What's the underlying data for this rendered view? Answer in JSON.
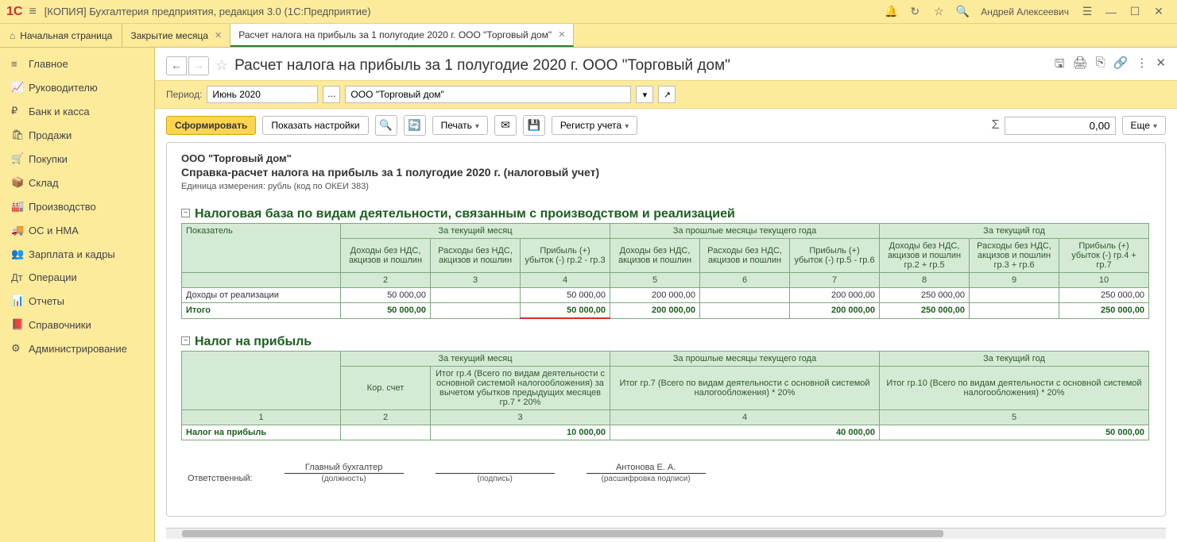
{
  "app": {
    "title": "[КОПИЯ] Бухгалтерия предприятия, редакция 3.0  (1С:Предприятие)",
    "user": "Андрей Алексеевич"
  },
  "tabs": {
    "home": "Начальная страница",
    "list": [
      {
        "label": "Закрытие месяца",
        "active": false
      },
      {
        "label": "Расчет налога на прибыль за 1 полугодие 2020 г. ООО \"Торговый дом\"",
        "active": true
      }
    ]
  },
  "sidebar": [
    {
      "icon": "≡",
      "label": "Главное"
    },
    {
      "icon": "📈",
      "label": "Руководителю"
    },
    {
      "icon": "₽",
      "label": "Банк и касса"
    },
    {
      "icon": "🛍",
      "label": "Продажи"
    },
    {
      "icon": "🛒",
      "label": "Покупки"
    },
    {
      "icon": "📦",
      "label": "Склад"
    },
    {
      "icon": "🏭",
      "label": "Производство"
    },
    {
      "icon": "🚚",
      "label": "ОС и НМА"
    },
    {
      "icon": "👥",
      "label": "Зарплата и кадры"
    },
    {
      "icon": "Дт",
      "label": "Операции"
    },
    {
      "icon": "📊",
      "label": "Отчеты"
    },
    {
      "icon": "📕",
      "label": "Справочники"
    },
    {
      "icon": "⚙",
      "label": "Администрирование"
    }
  ],
  "page": {
    "title": "Расчет налога на прибыль за 1 полугодие 2020 г. ООО \"Торговый дом\"",
    "period_label": "Период:",
    "period_value": "Июнь 2020",
    "org": "ООО \"Торговый дом\"",
    "toolbar": {
      "form": "Сформировать",
      "settings": "Показать настройки",
      "print": "Печать",
      "register": "Регистр учета",
      "more": "Еще"
    },
    "sum_value": "0,00"
  },
  "report": {
    "org_title": "ООО \"Торговый дом\"",
    "doc_title": "Справка-расчет налога на прибыль за 1 полугодие 2020 г. (налоговый учет)",
    "unit": "Единица измерения:  рубль (код по ОКЕИ 383)",
    "section1": {
      "title": "Налоговая база по видам деятельности, связанным с производством и реализацией",
      "col_indicator": "Показатель",
      "grp_current": "За текущий месяц",
      "grp_past": "За прошлые месяцы текущего года",
      "grp_year": "За текущий год",
      "hdr": {
        "c2": "Доходы без НДС, акцизов и пошлин",
        "c3": "Расходы без НДС, акцизов и пошлин",
        "c4": "Прибыль (+) убыток (-) гр.2 - гр.3",
        "c5": "Доходы без НДС, акцизов и пошлин",
        "c6": "Расходы без НДС, акцизов и пошлин",
        "c7": "Прибыль (+) убыток (-) гр.5 - гр.6",
        "c8": "Доходы без НДС, акцизов и пошлин гр.2 + гр.5",
        "c9": "Расходы без НДС, акцизов и пошлин гр.3 + гр.6",
        "c10": "Прибыль (+) убыток (-) гр.4 + гр.7"
      },
      "nums": {
        "n2": "2",
        "n3": "3",
        "n4": "4",
        "n5": "5",
        "n6": "6",
        "n7": "7",
        "n8": "8",
        "n9": "9",
        "n10": "10"
      },
      "row1_label": "Доходы от реализации",
      "row1": {
        "c2": "50 000,00",
        "c3": "",
        "c4": "50 000,00",
        "c5": "200 000,00",
        "c6": "",
        "c7": "200 000,00",
        "c8": "250 000,00",
        "c9": "",
        "c10": "250 000,00"
      },
      "total_label": "Итого",
      "total": {
        "c2": "50 000,00",
        "c3": "",
        "c4": "50 000,00",
        "c5": "200 000,00",
        "c6": "",
        "c7": "200 000,00",
        "c8": "250 000,00",
        "c9": "",
        "c10": "250 000,00"
      }
    },
    "section2": {
      "title": "Налог на прибыль",
      "grp_current": "За текущий месяц",
      "grp_past": "За прошлые месяцы текущего года",
      "grp_year": "За текущий год",
      "hdr": {
        "c2": "Кор. счет",
        "c3": "Итог гр.4 (Всего по видам деятельности с основной системой налогообложения) за вычетом убытков предыдущих месяцев гр.7 * 20%",
        "c4": "Итог гр.7 (Всего по видам деятельности с основной системой налогообложения) * 20%",
        "c5": "Итог гр.10 (Всего по видам деятельности с основной системой налогообложения) * 20%"
      },
      "nums": {
        "n1": "1",
        "n2": "2",
        "n3": "3",
        "n4": "4",
        "n5": "5"
      },
      "row_label": "Налог на прибыль",
      "row": {
        "c2": "",
        "c3": "10 000,00",
        "c4": "40 000,00",
        "c5": "50 000,00"
      }
    },
    "signatures": {
      "resp_label": "Ответственный:",
      "position": "Главный бухгалтер",
      "position_cap": "(должность)",
      "sign_cap": "(подпись)",
      "name": "Антонова Е. А.",
      "name_cap": "(расшифровка подписи)"
    }
  }
}
